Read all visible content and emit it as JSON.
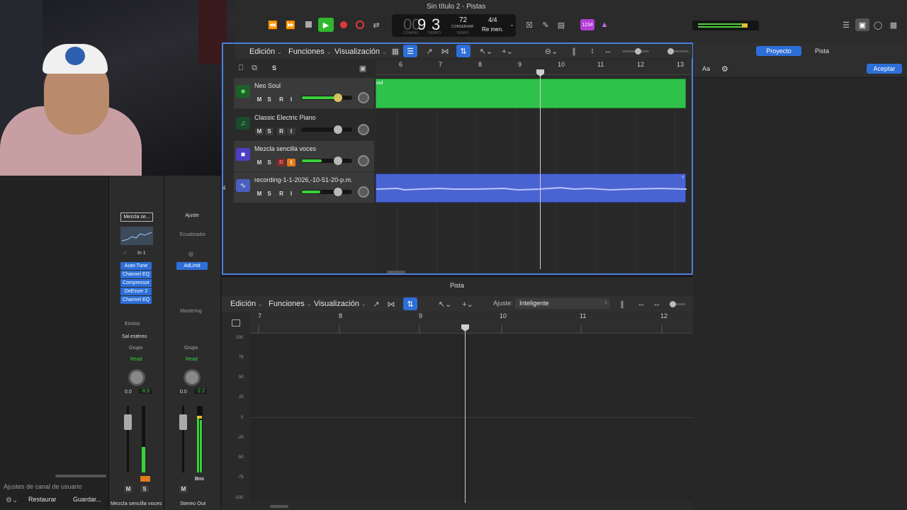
{
  "window": {
    "title": "Sin título 2 - Pistas"
  },
  "lcd": {
    "bar": "9",
    "beat": "3",
    "bar_label": "COMPÁS",
    "beat_label": "TIEMPO",
    "tempo": "72",
    "tempo_mode": "CONSERVAR",
    "tempo_label": "TEMPO",
    "signature": "4/4",
    "key": "Re men."
  },
  "toolbar": {
    "count_in": "1234"
  },
  "top_menus": {
    "edit": "Edición",
    "functions": "Funciones",
    "view": "Visualización"
  },
  "track_header": {
    "solo_label": "S"
  },
  "tracks": [
    {
      "name": "Neo Soul",
      "m": "M",
      "s": "S",
      "r": "R",
      "i": "I",
      "color": "#2fc24a"
    },
    {
      "name": "Classic Electric Piano",
      "m": "M",
      "s": "S",
      "r": "R",
      "i": "I",
      "color": "#2fc24a"
    },
    {
      "name": "Mezcla sencilla voces",
      "m": "M",
      "s": "S",
      "r": "R",
      "i": "I",
      "color": "#6f5cf0"
    },
    {
      "number": "4",
      "name": "recording-1-1-2026,-10-51-20-p.m.",
      "m": "M",
      "s": "S",
      "r": "R",
      "i": "I",
      "color": "#6a7ee8"
    }
  ],
  "ruler": [
    "6",
    "7",
    "8",
    "9",
    "10",
    "11",
    "12",
    "13"
  ],
  "regions": {
    "neo_soul_label": "oul",
    "recording_label": "r"
  },
  "inspector": {
    "tabs": [
      "Proyecto",
      "Pista"
    ],
    "font_btn": "Aa",
    "accept": "Aceptar"
  },
  "channel_strip_left": {
    "setting": "Mezcla se...",
    "input": "In 1",
    "plugins": [
      "Auto-Tune",
      "Channel EQ",
      "Compressor",
      "DeEsser 2",
      "Channel EQ"
    ],
    "sends": "Envíos",
    "output": "Sal estéreo",
    "group": "Grupo",
    "automation": "Read",
    "vol": "0.0",
    "peak": "-8.9",
    "m": "M",
    "s": "S",
    "name": "Mezcla sencilla voces"
  },
  "channel_strip_right": {
    "setting": "Ajuste",
    "eq": "Ecualizador",
    "plugins": [
      "AdLimit"
    ],
    "mastering": "Mastering",
    "group": "Grupo",
    "automation": "Read",
    "vol": "0.0",
    "peak": "-2.2",
    "m": "M",
    "bnc": "Bnc",
    "name": "Stereo Out"
  },
  "left_panel": {
    "user_channel": "Ajustes de canal de usuario",
    "restore": "Restaurar",
    "save": "Guardar..."
  },
  "editor": {
    "title": "Pista",
    "edit": "Edición",
    "functions": "Funciones",
    "view": "Visualización",
    "snap_label": "Ajuste:",
    "snap_value": "Inteligente",
    "ruler": [
      "7",
      "8",
      "9",
      "10",
      "11",
      "12"
    ],
    "yaxis": [
      "100",
      "75",
      "50",
      "25",
      "0",
      "-25",
      "-50",
      "-75",
      "-100"
    ]
  }
}
